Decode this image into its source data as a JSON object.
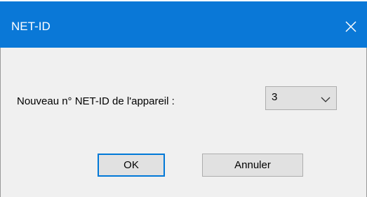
{
  "window": {
    "title": "NET-ID",
    "accent_color": "#0a78d7",
    "close_icon": "close-icon"
  },
  "form": {
    "label": "Nouveau n° NET-ID de l'appareil :",
    "netid_select": {
      "selected_value": "3",
      "chevron_icon": "chevron-down-icon"
    }
  },
  "buttons": {
    "ok_label": "OK",
    "cancel_label": "Annuler"
  }
}
